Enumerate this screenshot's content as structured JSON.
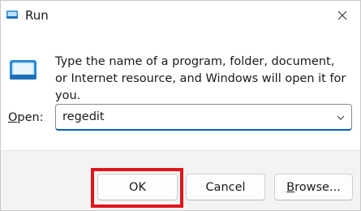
{
  "window": {
    "title": "Run",
    "title_icon": "run-icon",
    "close_icon": "close-icon"
  },
  "body": {
    "icon": "run-icon",
    "description": "Type the name of a program, folder, document, or Internet resource, and Windows will open it for you."
  },
  "open": {
    "label_accel": "O",
    "label_rest": "pen:",
    "value": "regedit",
    "dropdown_icon": "chevron-down-icon"
  },
  "buttons": {
    "ok": "OK",
    "cancel": "Cancel",
    "browse_accel": "B",
    "browse_rest": "rowse..."
  },
  "colors": {
    "accent": "#005fb8",
    "highlight": "#e0151d",
    "footer_bg": "#f3f3f3"
  }
}
